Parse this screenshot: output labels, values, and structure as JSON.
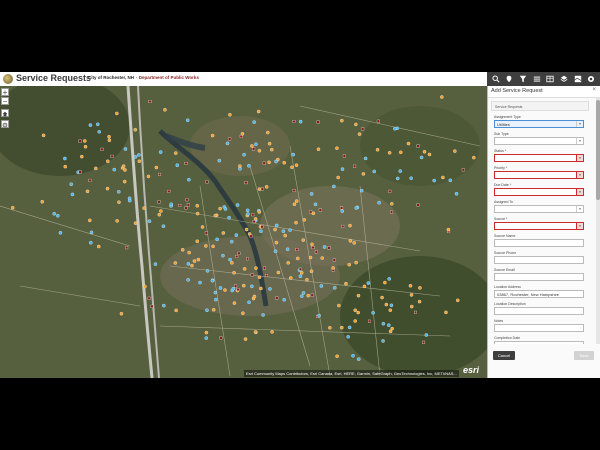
{
  "header": {
    "title": "Service Requests",
    "city": "City of Rochester, NH",
    "separator": "·",
    "department": "Department of Public Works"
  },
  "toolbar": {
    "icons": [
      "search-icon",
      "pin-icon",
      "filter-icon",
      "list-icon",
      "table-icon",
      "layers-icon",
      "basemap-icon",
      "share-icon"
    ]
  },
  "map": {
    "zoom_in": "+",
    "zoom_out": "−",
    "attribution": "Esri Community Maps Contributors, Esri Canada, Esri, HERE, Garmin, SafeGraph, GeoTechnologies, Inc, METI/NAS...",
    "esri": "esri"
  },
  "panel": {
    "title": "Add Service Request",
    "close": "×",
    "layer": "Service Requests",
    "fields": [
      {
        "label": "Assignment Type",
        "value": "Utilities",
        "required": false,
        "dropdown": true,
        "selected": true
      },
      {
        "label": "Sub Type",
        "value": "",
        "required": false,
        "dropdown": true
      },
      {
        "label": "Status *",
        "value": "",
        "required": true,
        "dropdown": true
      },
      {
        "label": "Priority *",
        "value": "",
        "required": true,
        "dropdown": true
      },
      {
        "label": "Due Date *",
        "value": "",
        "required": true,
        "dropdown": true
      },
      {
        "label": "Assigned To",
        "value": "",
        "required": false,
        "dropdown": true
      },
      {
        "label": "Source *",
        "value": "",
        "required": true,
        "dropdown": true
      },
      {
        "label": "Source Name",
        "value": "",
        "required": false,
        "dropdown": false
      },
      {
        "label": "Source Phone",
        "value": "",
        "required": false,
        "dropdown": false
      },
      {
        "label": "Source Email",
        "value": "",
        "required": false,
        "dropdown": false
      },
      {
        "label": "Location Address",
        "value": "03867, Rochester, New Hampshire",
        "required": false,
        "dropdown": false
      },
      {
        "label": "Location Description",
        "value": "",
        "required": false,
        "dropdown": false
      },
      {
        "label": "Notes",
        "value": "",
        "required": false,
        "dropdown": false
      },
      {
        "label": "Completion Date",
        "value": "",
        "required": false,
        "dropdown": false
      }
    ],
    "cancel": "Cancel",
    "save": "Save"
  },
  "colors": {
    "toolbar": "#3e3e3e",
    "required": "#cc2b2b",
    "orange_points": "#f0a030",
    "blue_points": "#4fb3e8",
    "red_points": "#8b1a1a",
    "department_text": "#8a1c1c"
  }
}
